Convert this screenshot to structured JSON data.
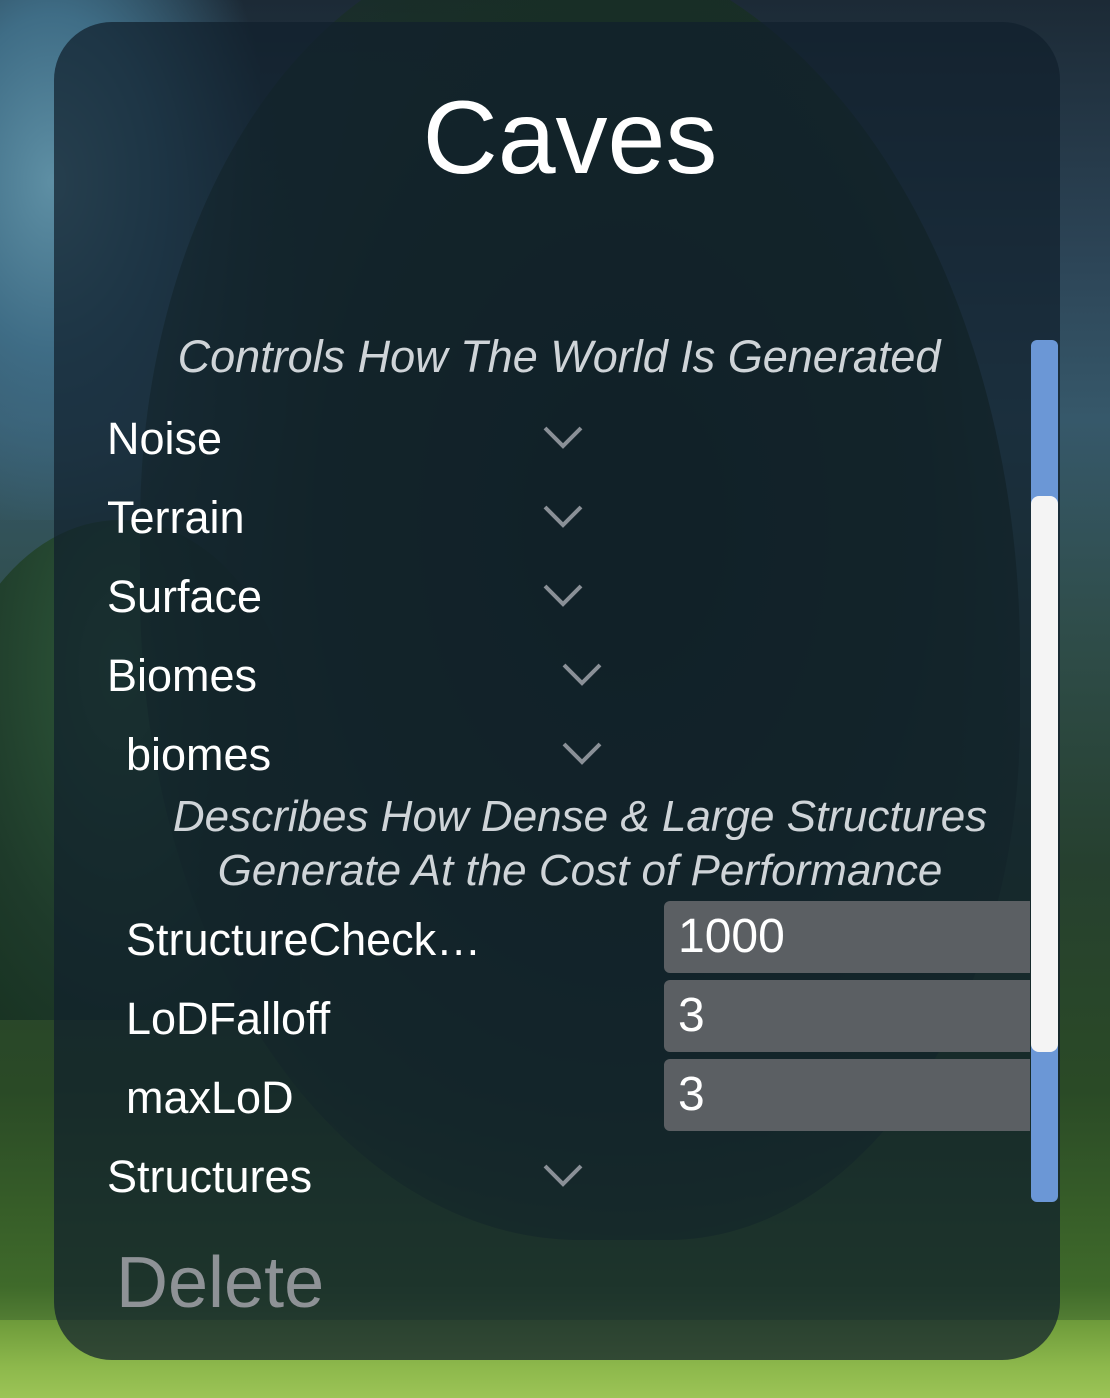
{
  "panel": {
    "title": "Caves",
    "description": "Controls How The World Is Generated",
    "sections": {
      "noise": "Noise",
      "terrain": "Terrain",
      "surface": "Surface",
      "biomes": "Biomes",
      "biomes_sub": "biomes",
      "structures": "Structures"
    },
    "biomes_description_line1": "Describes How Dense & Large Structures",
    "biomes_description_line2": "Generate At the Cost of Performance",
    "fields": {
      "structure_check_label": "StructureCheck…",
      "structure_check_value": "1000",
      "lod_falloff_label": "LoDFalloff",
      "lod_falloff_value": "3",
      "max_lod_label": "maxLoD",
      "max_lod_value": "3"
    },
    "delete_label": "Delete"
  },
  "icons": {
    "expand": "chevron-down-icon"
  },
  "colors": {
    "scrollbar_track": "#6b97d6",
    "scrollbar_thumb": "#f4f4f4",
    "field_background": "#5b5f63",
    "delete_text": "#8e9296"
  }
}
